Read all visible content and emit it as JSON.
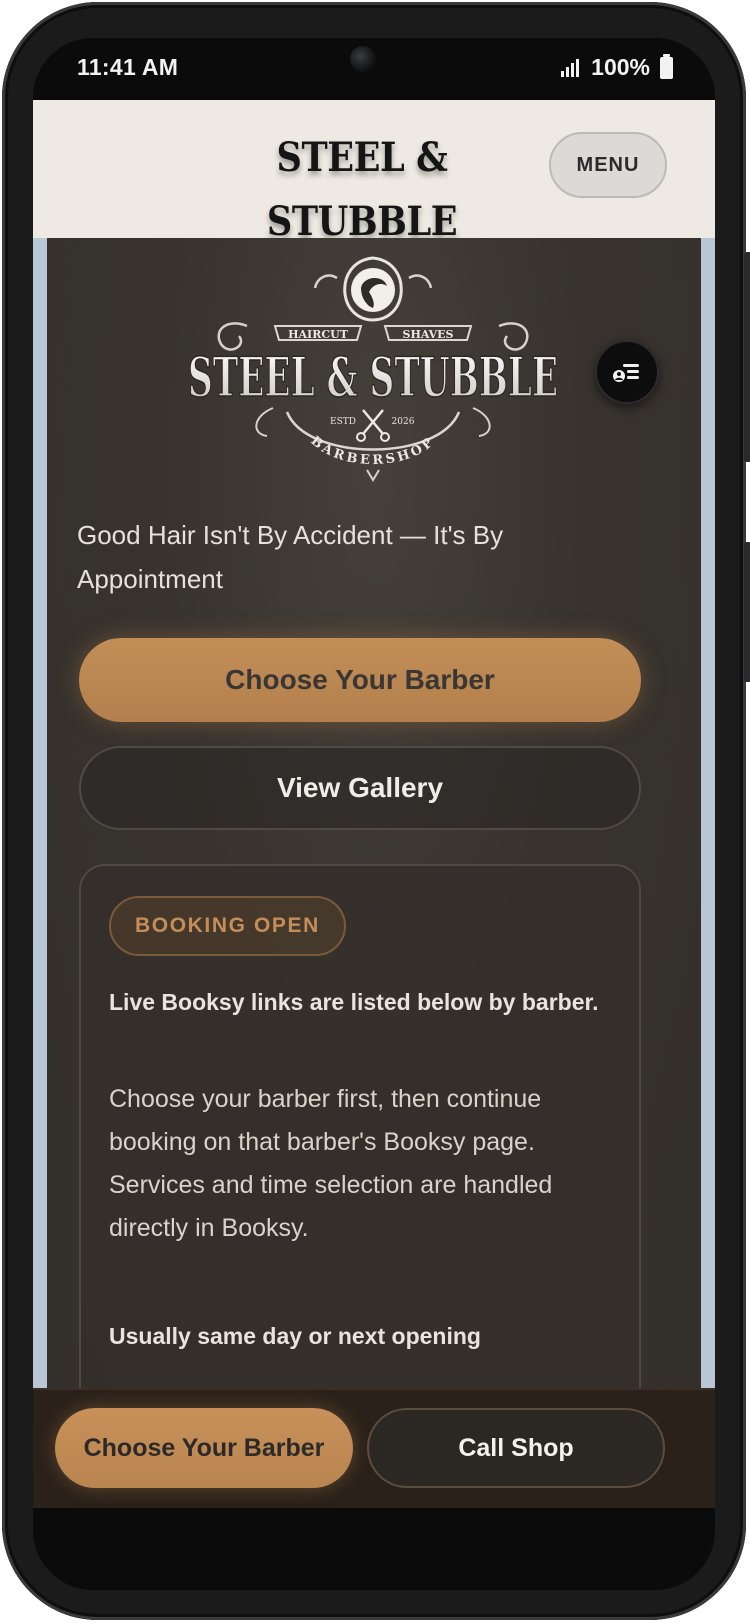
{
  "status_bar": {
    "time": "11:41 AM",
    "battery": "100%"
  },
  "header": {
    "brand": "STEEL & STUBBLE",
    "menu_label": "MENU"
  },
  "emblem": {
    "left_banner": "HAIRCUT",
    "right_banner": "SHAVES",
    "name": "STEEL & STUBBLE",
    "estd_label": "ESTD",
    "year": "2026",
    "ribbon": "BARBERSHOP"
  },
  "hero": {
    "tagline": "Good Hair Isn't By Accident — It's By Appointment",
    "primary_button": "Choose Your Barber",
    "secondary_button": "View Gallery"
  },
  "booking_card": {
    "badge": "BOOKING OPEN",
    "lead": "Live Booksy links are listed below by barber.",
    "body": "Choose your barber first, then continue booking on that barber's Booksy page. Services and time selection are handled directly in Booksy.",
    "note": "Usually same day or next opening"
  },
  "bottom_bar": {
    "primary_button": "Choose Your Barber",
    "secondary_button": "Call Shop"
  },
  "colors": {
    "accent": "#c28e58",
    "header_bg": "#eeeae3",
    "content_bg": "#38332e",
    "badge_text": "#c58d57"
  },
  "icons": {
    "floating_button": "account-list-icon",
    "signal": "signal-icon",
    "battery": "battery-icon",
    "emblem": "barber-emblem-icon"
  }
}
